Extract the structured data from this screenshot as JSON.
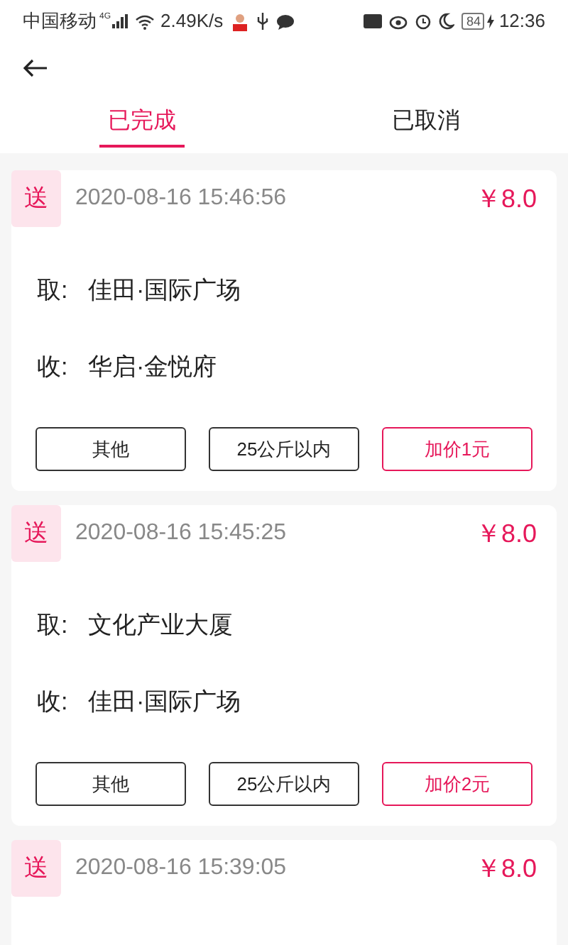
{
  "status_bar": {
    "carrier": "中国移动",
    "network": "4G",
    "speed": "2.49K/s",
    "battery": "84",
    "time": "12:36"
  },
  "tabs": [
    {
      "label": "已完成",
      "selected": true
    },
    {
      "label": "已取消",
      "selected": false
    }
  ],
  "orders": [
    {
      "badge": "送",
      "time": "2020-08-16 15:46:56",
      "price": "￥8.0",
      "pickup_label": "取:",
      "pickup": "佳田·国际广场",
      "dropoff_label": "收:",
      "dropoff": "华启·金悦府",
      "buttons": [
        {
          "label": "其他",
          "highlight": false
        },
        {
          "label": "25公斤以内",
          "highlight": false
        },
        {
          "label": "加价1元",
          "highlight": true
        }
      ]
    },
    {
      "badge": "送",
      "time": "2020-08-16 15:45:25",
      "price": "￥8.0",
      "pickup_label": "取:",
      "pickup": "文化产业大厦",
      "dropoff_label": "收:",
      "dropoff": "佳田·国际广场",
      "buttons": [
        {
          "label": "其他",
          "highlight": false
        },
        {
          "label": "25公斤以内",
          "highlight": false
        },
        {
          "label": "加价2元",
          "highlight": true
        }
      ]
    },
    {
      "badge": "送",
      "time": "2020-08-16 15:39:05",
      "price": "￥8.0"
    }
  ]
}
